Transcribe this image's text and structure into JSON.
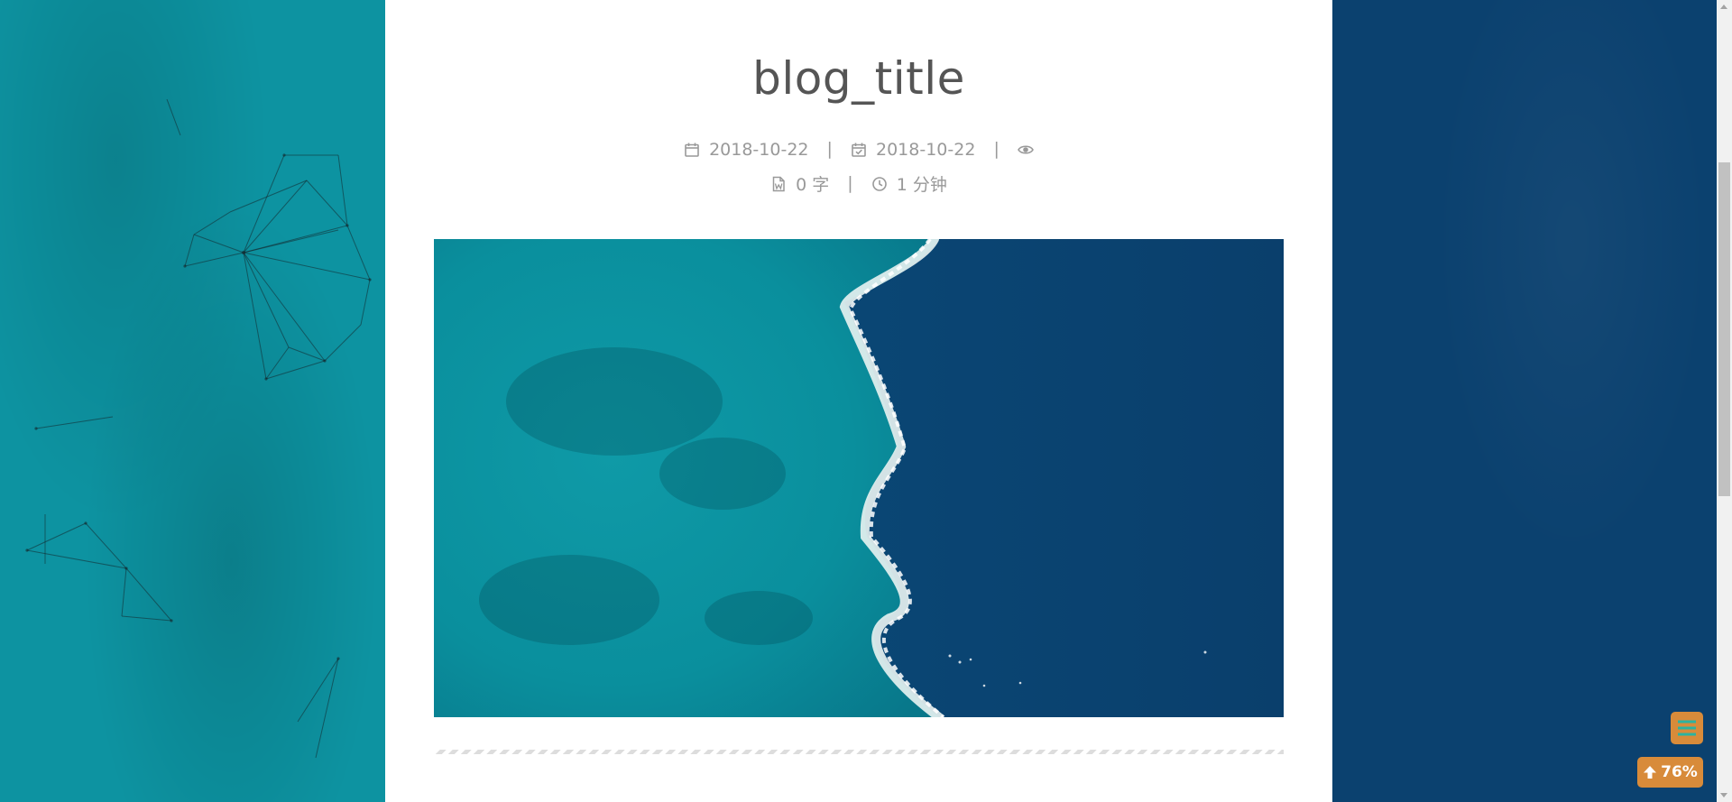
{
  "post": {
    "title": "blog_title",
    "created_date": "2018-10-22",
    "updated_date": "2018-10-22",
    "word_count": "0 字",
    "read_time": "1 分钟",
    "separator": "|"
  },
  "icons": {
    "created": "calendar-icon",
    "updated": "calendar-check-icon",
    "views": "eye-icon",
    "words": "file-word-icon",
    "time": "clock-icon",
    "menu": "hamburger-menu-icon",
    "backtop": "arrow-up-icon"
  },
  "widgets": {
    "back_to_top_percent": "76%"
  },
  "colors": {
    "accent": "#d88b3a",
    "sea_turquoise": "#0d93a1",
    "sea_deep": "#0b416f",
    "menu_lines": "#2bb3a0"
  }
}
